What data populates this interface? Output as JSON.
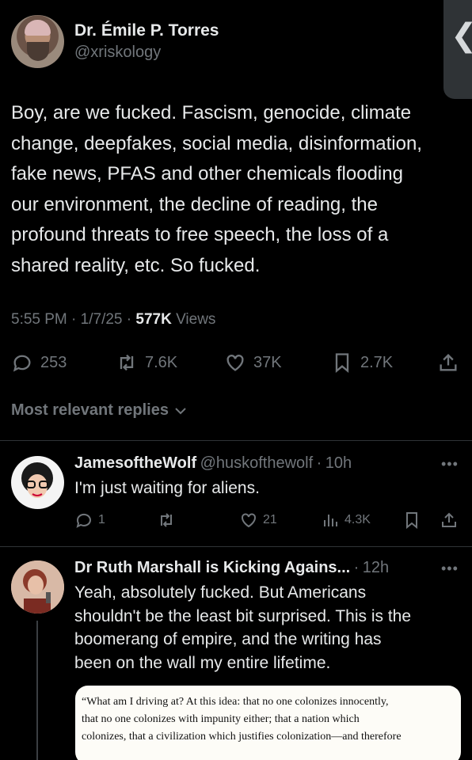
{
  "tweet": {
    "author_name": "Dr. Émile P. Torres",
    "author_handle": "@xriskology",
    "text_lines": [
      "Boy, are we fucked. Fascism, genocide, climate",
      "change, deepfakes, social media, disinformation,",
      "fake news, PFAS and other chemicals flooding",
      "our environment, the decline of reading, the",
      "profound threats to free speech, the loss of a",
      "shared reality, etc. So fucked."
    ],
    "time": "5:55 PM",
    "date": "1/7/25",
    "views_count": "577K",
    "views_label": "Views",
    "replies": "253",
    "reposts": "7.6K",
    "likes": "37K",
    "bookmarks": "2.7K"
  },
  "replies_header": "Most relevant replies",
  "replies": [
    {
      "name": "JamesoftheWolf",
      "handle": "@huskofthewolf",
      "time": "10h",
      "text": "I'm just waiting for aliens.",
      "reply_count": "1",
      "repost_count": "",
      "like_count": "21",
      "view_count": "4.3K"
    },
    {
      "name": "Dr Ruth Marshall is Kicking Agains...",
      "time": "12h",
      "text_lines": [
        "Yeah, absolutely fucked. But Americans",
        "shouldn't be the least bit surprised. This is the",
        "boomerang of empire, and the writing has",
        "been on the wall my entire lifetime."
      ],
      "quote_lines": [
        "“What am I driving at? At this idea: that no one colonizes innocently,",
        "that no one colonizes with impunity either; that a nation which",
        "colonizes, that a civilization which justifies colonization—and therefore"
      ]
    }
  ],
  "separator": "·",
  "back_glyph": "❮",
  "more_glyph": "•••",
  "colors": {
    "background": "#000000",
    "text": "#e7e9ea",
    "muted": "#71767b",
    "divider": "#2f3336"
  }
}
